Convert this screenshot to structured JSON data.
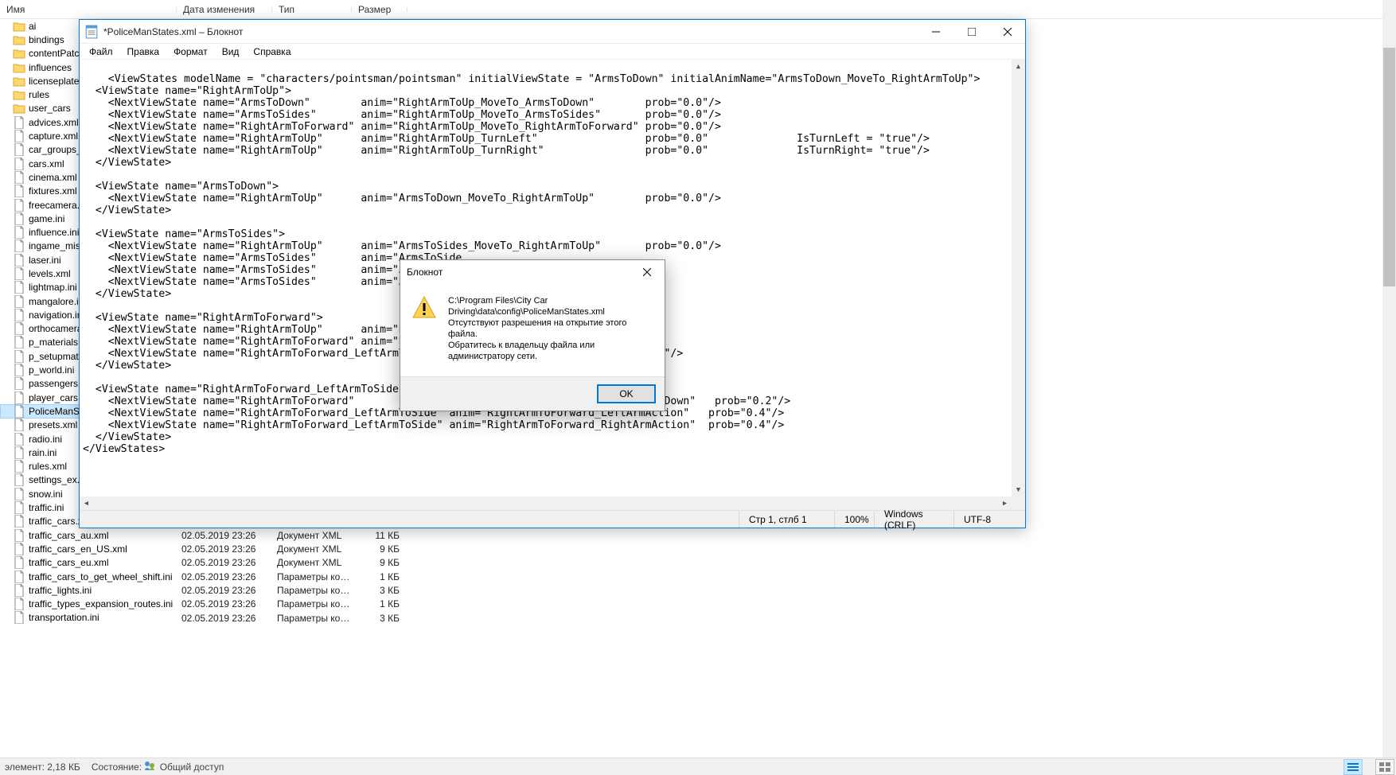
{
  "explorer": {
    "columns": {
      "name": "Имя",
      "date": "Дата изменения",
      "type": "Тип",
      "size": "Размер"
    },
    "folders": [
      "ai",
      "bindings",
      "contentPatches",
      "influences",
      "licenseplates",
      "rules",
      "user_cars"
    ],
    "files": [
      "advices.xml",
      "capture.xml",
      "car_groups_settin",
      "cars.xml",
      "cinema.xml",
      "fixtures.xml",
      "freecamera.ini",
      "game.ini",
      "influence.ini",
      "ingame_mission",
      "laser.ini",
      "levels.xml",
      "lightmap.ini",
      "mangalore.ini",
      "navigation.ini",
      "orthocamera.ini",
      "p_materials.xml",
      "p_setupmaterial",
      "p_world.ini",
      "passengers.ini",
      "player_cars.xml",
      "PoliceManStates.",
      "presets.xml",
      "radio.ini",
      "rain.ini",
      "rules.xml",
      "settings_ex.ini",
      "snow.ini",
      "traffic.ini",
      "traffic_cars.xml",
      "traffic_cars_au.xml",
      "traffic_cars_en_US.xml",
      "traffic_cars_eu.xml",
      "traffic_cars_to_get_wheel_shift.ini",
      "traffic_lights.ini",
      "traffic_types_expansion_routes.ini",
      "transportation.ini"
    ],
    "selectedIndex": 21,
    "visibleDetails": [
      {
        "date": "02.05.2019 23:26",
        "type": "Документ XML",
        "size": "11 КБ"
      },
      {
        "date": "02.05.2019 23:26",
        "type": "Документ XML",
        "size": "9 КБ"
      },
      {
        "date": "02.05.2019 23:26",
        "type": "Документ XML",
        "size": "9 КБ"
      },
      {
        "date": "02.05.2019 23:26",
        "type": "Параметры конф...",
        "size": "1 КБ"
      },
      {
        "date": "02.05.2019 23:26",
        "type": "Параметры конф...",
        "size": "3 КБ"
      },
      {
        "date": "02.05.2019 23:26",
        "type": "Параметры конф...",
        "size": "1 КБ"
      },
      {
        "date": "02.05.2019 23:26",
        "type": "Параметры конф...",
        "size": "3 КБ"
      }
    ],
    "status": {
      "items": "элемент: 2,18 КБ",
      "state_label": "Состояние:",
      "state_value": "Общий доступ"
    }
  },
  "notepad": {
    "title": "*PoliceManStates.xml – Блокнот",
    "menu": [
      "Файл",
      "Правка",
      "Формат",
      "Вид",
      "Справка"
    ],
    "content": "<ViewStates modelName = \"characters/pointsman/pointsman\" initialViewState = \"ArmsToDown\" initialAnimName=\"ArmsToDown_MoveTo_RightArmToUp\">\n  <ViewState name=\"RightArmToUp\">\n    <NextViewState name=\"ArmsToDown\"        anim=\"RightArmToUp_MoveTo_ArmsToDown\"        prob=\"0.0\"/>\n    <NextViewState name=\"ArmsToSides\"       anim=\"RightArmToUp_MoveTo_ArmsToSides\"       prob=\"0.0\"/>\n    <NextViewState name=\"RightArmToForward\" anim=\"RightArmToUp_MoveTo_RightArmToForward\" prob=\"0.0\"/>\n    <NextViewState name=\"RightArmToUp\"      anim=\"RightArmToUp_TurnLeft\"                 prob=\"0.0\"              IsTurnLeft = \"true\"/>\n    <NextViewState name=\"RightArmToUp\"      anim=\"RightArmToUp_TurnRight\"                prob=\"0.0\"              IsTurnRight= \"true\"/>\n  </ViewState>\n  \n  <ViewState name=\"ArmsToDown\">\n    <NextViewState name=\"RightArmToUp\"      anim=\"ArmsToDown_MoveTo_RightArmToUp\"        prob=\"0.0\"/>\n  </ViewState>\n  \n  <ViewState name=\"ArmsToSides\">\n    <NextViewState name=\"RightArmToUp\"      anim=\"ArmsToSides_MoveTo_RightArmToUp\"       prob=\"0.0\"/>\n    <NextViewState name=\"ArmsToSides\"       anim=\"ArmsToSide\n    <NextViewState name=\"ArmsToSides\"       anim=\"ArmsToSide\n    <NextViewState name=\"ArmsToSides\"       anim=\"ArmsToSide\n  </ViewState>\n  \n  <ViewState name=\"RightArmToForward\">\n    <NextViewState name=\"RightArmToUp\"      anim=\"RightArmTo\n    <NextViewState name=\"RightArmToForward\" anim=\"RightArmTo\n    <NextViewState name=\"RightArmToForward_LeftArmToSide\" an                             0.5\"/>\n  </ViewState>\n  \n  <ViewState name=\"RightArmToForward_LeftArmToSide\">\n    <NextViewState name=\"RightArmToForward\"                anim=\"RightArmToForward_LeftArmToDown\"   prob=\"0.2\"/>\n    <NextViewState name=\"RightArmToForward_LeftArmToSide\" anim=\"RightArmToForward_LeftArmAction\"   prob=\"0.4\"/>\n    <NextViewState name=\"RightArmToForward_LeftArmToSide\" anim=\"RightArmToForward_RightArmAction\"  prob=\"0.4\"/>\n  </ViewState>\n</ViewStates>",
    "status": {
      "pos": "Стр 1, стлб 1",
      "zoom": "100%",
      "eol": "Windows (CRLF)",
      "enc": "UTF-8"
    }
  },
  "dialog": {
    "title": "Блокнот",
    "lines": [
      "C:\\Program Files\\City Car",
      "Driving\\data\\config\\PoliceManStates.xml",
      "Отсутствуют разрешения на открытие этого файла.",
      "Обратитесь к владельцу файла или администратору сети."
    ],
    "ok": "OK"
  }
}
